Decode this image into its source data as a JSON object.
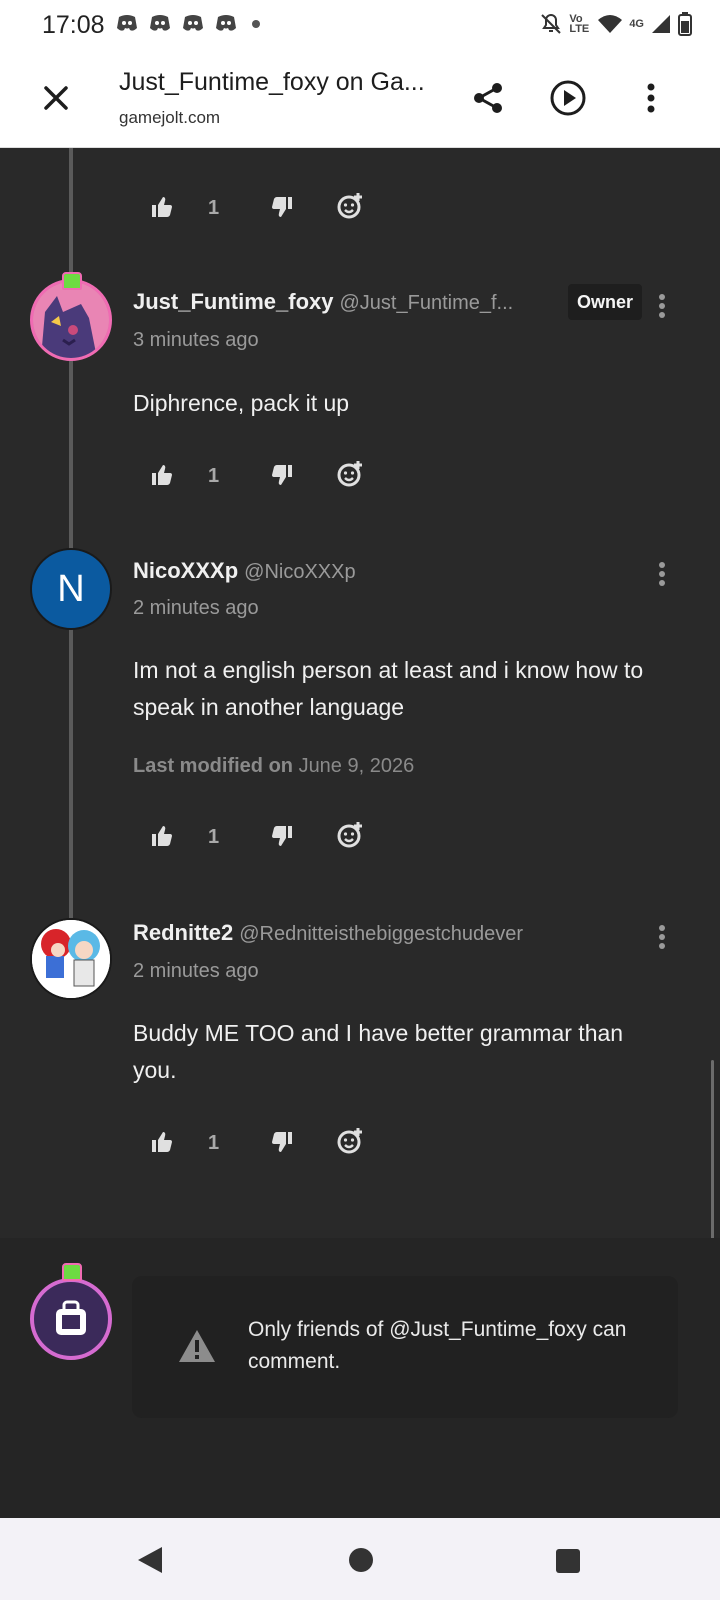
{
  "status_bar": {
    "time": "17:08",
    "network": "4G",
    "volte": "Vo LTE"
  },
  "browser": {
    "title": "Just_Funtime_foxy on Ga...",
    "domain": "gamejolt.com"
  },
  "comments": [
    {
      "like_count": "1"
    },
    {
      "name": "Just_Funtime_foxy",
      "handle": "@Just_Funtime_f...",
      "tag": "Owner",
      "time": "3 minutes ago",
      "body": "Diphrence, pack it up",
      "like_count": "1"
    },
    {
      "name": "NicoXXXp",
      "handle": "@NicoXXXp",
      "avatar_letter": "N",
      "time": "2 minutes ago",
      "body": "Im not a english person at least and i know how to speak in another language",
      "modified_label": "Last modified on",
      "modified_date": "June 9, 2026",
      "like_count": "1"
    },
    {
      "name": "Rednitte2",
      "handle": "@Rednitteisthebiggestchudever",
      "time": "2 minutes ago",
      "body": "Buddy ME TOO and I have better grammar than you.",
      "like_count": "1"
    }
  ],
  "comment_notice": "Only friends of @Just_Funtime_foxy can comment.",
  "colors": {
    "accent_avatar_blue": "#0b5aa0",
    "badge_green": "#6ddb42",
    "badge_pink": "#f06bb3"
  }
}
